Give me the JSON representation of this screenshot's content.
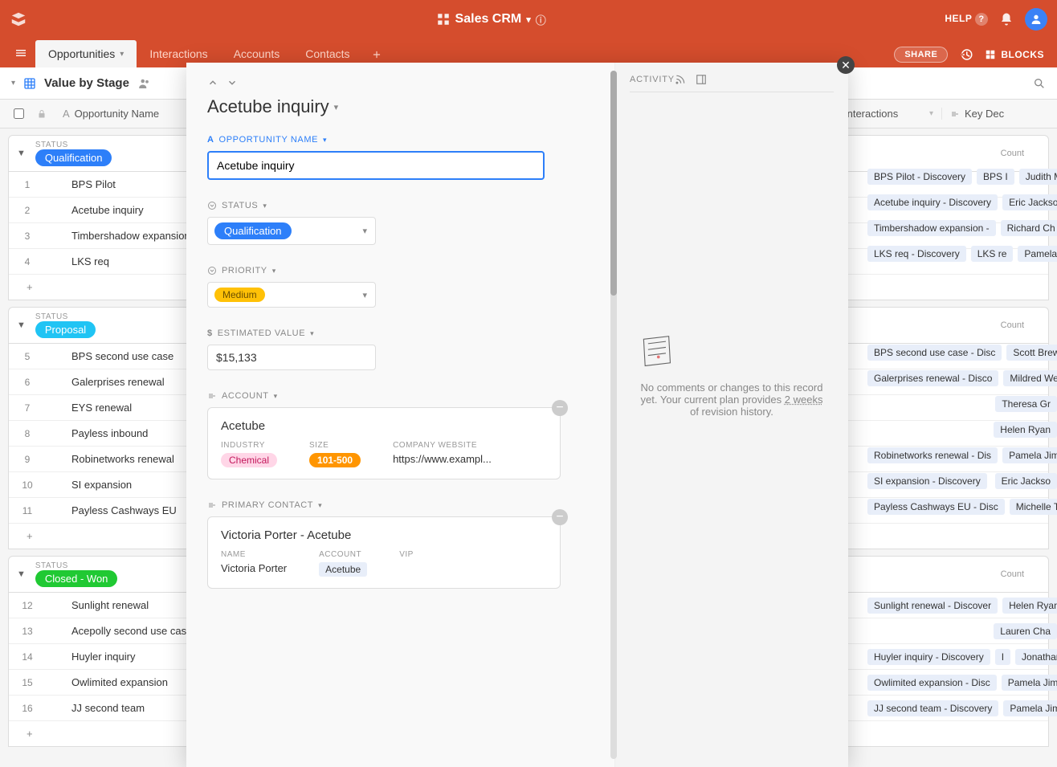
{
  "header": {
    "app_title": "Sales CRM",
    "help": "HELP",
    "share": "SHARE",
    "blocks": "BLOCKS"
  },
  "tabs": [
    {
      "label": "Opportunities",
      "active": true
    },
    {
      "label": "Interactions",
      "active": false
    },
    {
      "label": "Accounts",
      "active": false
    },
    {
      "label": "Contacts",
      "active": false
    }
  ],
  "view": {
    "name": "Value by Stage"
  },
  "columns": {
    "name": "Opportunity Name",
    "interactions": "Interactions",
    "key": "Key Dec"
  },
  "groups": [
    {
      "status_label": "STATUS",
      "pill": "Qualification",
      "pill_class": "qualification",
      "count_label": "Count",
      "rows": [
        {
          "n": "1",
          "name": "BPS Pilot",
          "inter": "BPS Pilot - Discovery",
          "inter2": "BPS I",
          "key": "Judith May"
        },
        {
          "n": "2",
          "name": "Acetube inquiry",
          "inter": "Acetube inquiry - Discovery",
          "inter2": "",
          "key": "Eric Jackso"
        },
        {
          "n": "3",
          "name": "Timbershadow expansion",
          "inter": "Timbershadow expansion -",
          "inter2": "",
          "key": "Richard Ch"
        },
        {
          "n": "4",
          "name": "LKS req",
          "inter": "LKS req - Discovery",
          "inter2": "LKS re",
          "key": "Pamela Jim"
        }
      ]
    },
    {
      "status_label": "STATUS",
      "pill": "Proposal",
      "pill_class": "proposal",
      "count_label": "Count",
      "rows": [
        {
          "n": "5",
          "name": "BPS second use case",
          "inter": "BPS second use case - Disc",
          "inter2": "",
          "key": "Scott Brew"
        },
        {
          "n": "6",
          "name": "Galerprises renewal",
          "inter": "Galerprises renewal - Disco",
          "inter2": "",
          "key": "Mildred We"
        },
        {
          "n": "7",
          "name": "EYS renewal",
          "inter": "",
          "inter2": "",
          "key": "Theresa Gr"
        },
        {
          "n": "8",
          "name": "Payless inbound",
          "inter": "",
          "inter2": "",
          "key": "Helen Ryan"
        },
        {
          "n": "9",
          "name": "Robinetworks renewal",
          "inter": "Robinetworks renewal - Dis",
          "inter2": "",
          "key": "Pamela Jim"
        },
        {
          "n": "10",
          "name": "SI expansion",
          "inter": "SI expansion - Discovery",
          "inter2": "",
          "key": "Eric Jackso"
        },
        {
          "n": "11",
          "name": "Payless Cashways EU",
          "inter": "Payless Cashways EU - Disc",
          "inter2": "",
          "key": "Michelle To"
        }
      ]
    },
    {
      "status_label": "STATUS",
      "pill": "Closed - Won",
      "pill_class": "closed-won",
      "count_label": "Count",
      "rows": [
        {
          "n": "12",
          "name": "Sunlight renewal",
          "inter": "Sunlight renewal - Discover",
          "inter2": "",
          "key": "Helen Ryan"
        },
        {
          "n": "13",
          "name": "Acepolly second use cas",
          "inter": "",
          "inter2": "",
          "key": "Lauren Cha"
        },
        {
          "n": "14",
          "name": "Huyler inquiry",
          "inter": "Huyler inquiry - Discovery",
          "inter2": "I",
          "key": "Jonathan B"
        },
        {
          "n": "15",
          "name": "Owlimited expansion",
          "inter": "Owlimited expansion - Disc",
          "inter2": "",
          "key": "Pamela Jim"
        },
        {
          "n": "16",
          "name": "JJ second team",
          "inter": "JJ second team - Discovery",
          "inter2": "",
          "key": "Pamela Jim"
        }
      ]
    }
  ],
  "record": {
    "title": "Acetube inquiry",
    "fields": {
      "opportunity_name": {
        "label": "OPPORTUNITY NAME",
        "value": "Acetube inquiry"
      },
      "status": {
        "label": "STATUS",
        "value": "Qualification"
      },
      "priority": {
        "label": "PRIORITY",
        "value": "Medium"
      },
      "estimated_value": {
        "label": "ESTIMATED VALUE",
        "value": "$15,133"
      },
      "account": {
        "label": "ACCOUNT"
      },
      "primary_contact": {
        "label": "PRIMARY CONTACT"
      }
    },
    "account_card": {
      "name": "Acetube",
      "industry_label": "INDUSTRY",
      "industry": "Chemical",
      "size_label": "SIZE",
      "size": "101-500",
      "website_label": "COMPANY WEBSITE",
      "website": "https://www.exampl..."
    },
    "contact_card": {
      "title": "Victoria Porter - Acetube",
      "name_label": "NAME",
      "name": "Victoria Porter",
      "account_label": "ACCOUNT",
      "account": "Acetube",
      "vip_label": "VIP"
    }
  },
  "activity": {
    "title": "ACTIVITY",
    "empty_line1": "No comments or changes to this record yet. Your current plan provides",
    "empty_link": "2 weeks",
    "empty_line2": " of revision history."
  }
}
